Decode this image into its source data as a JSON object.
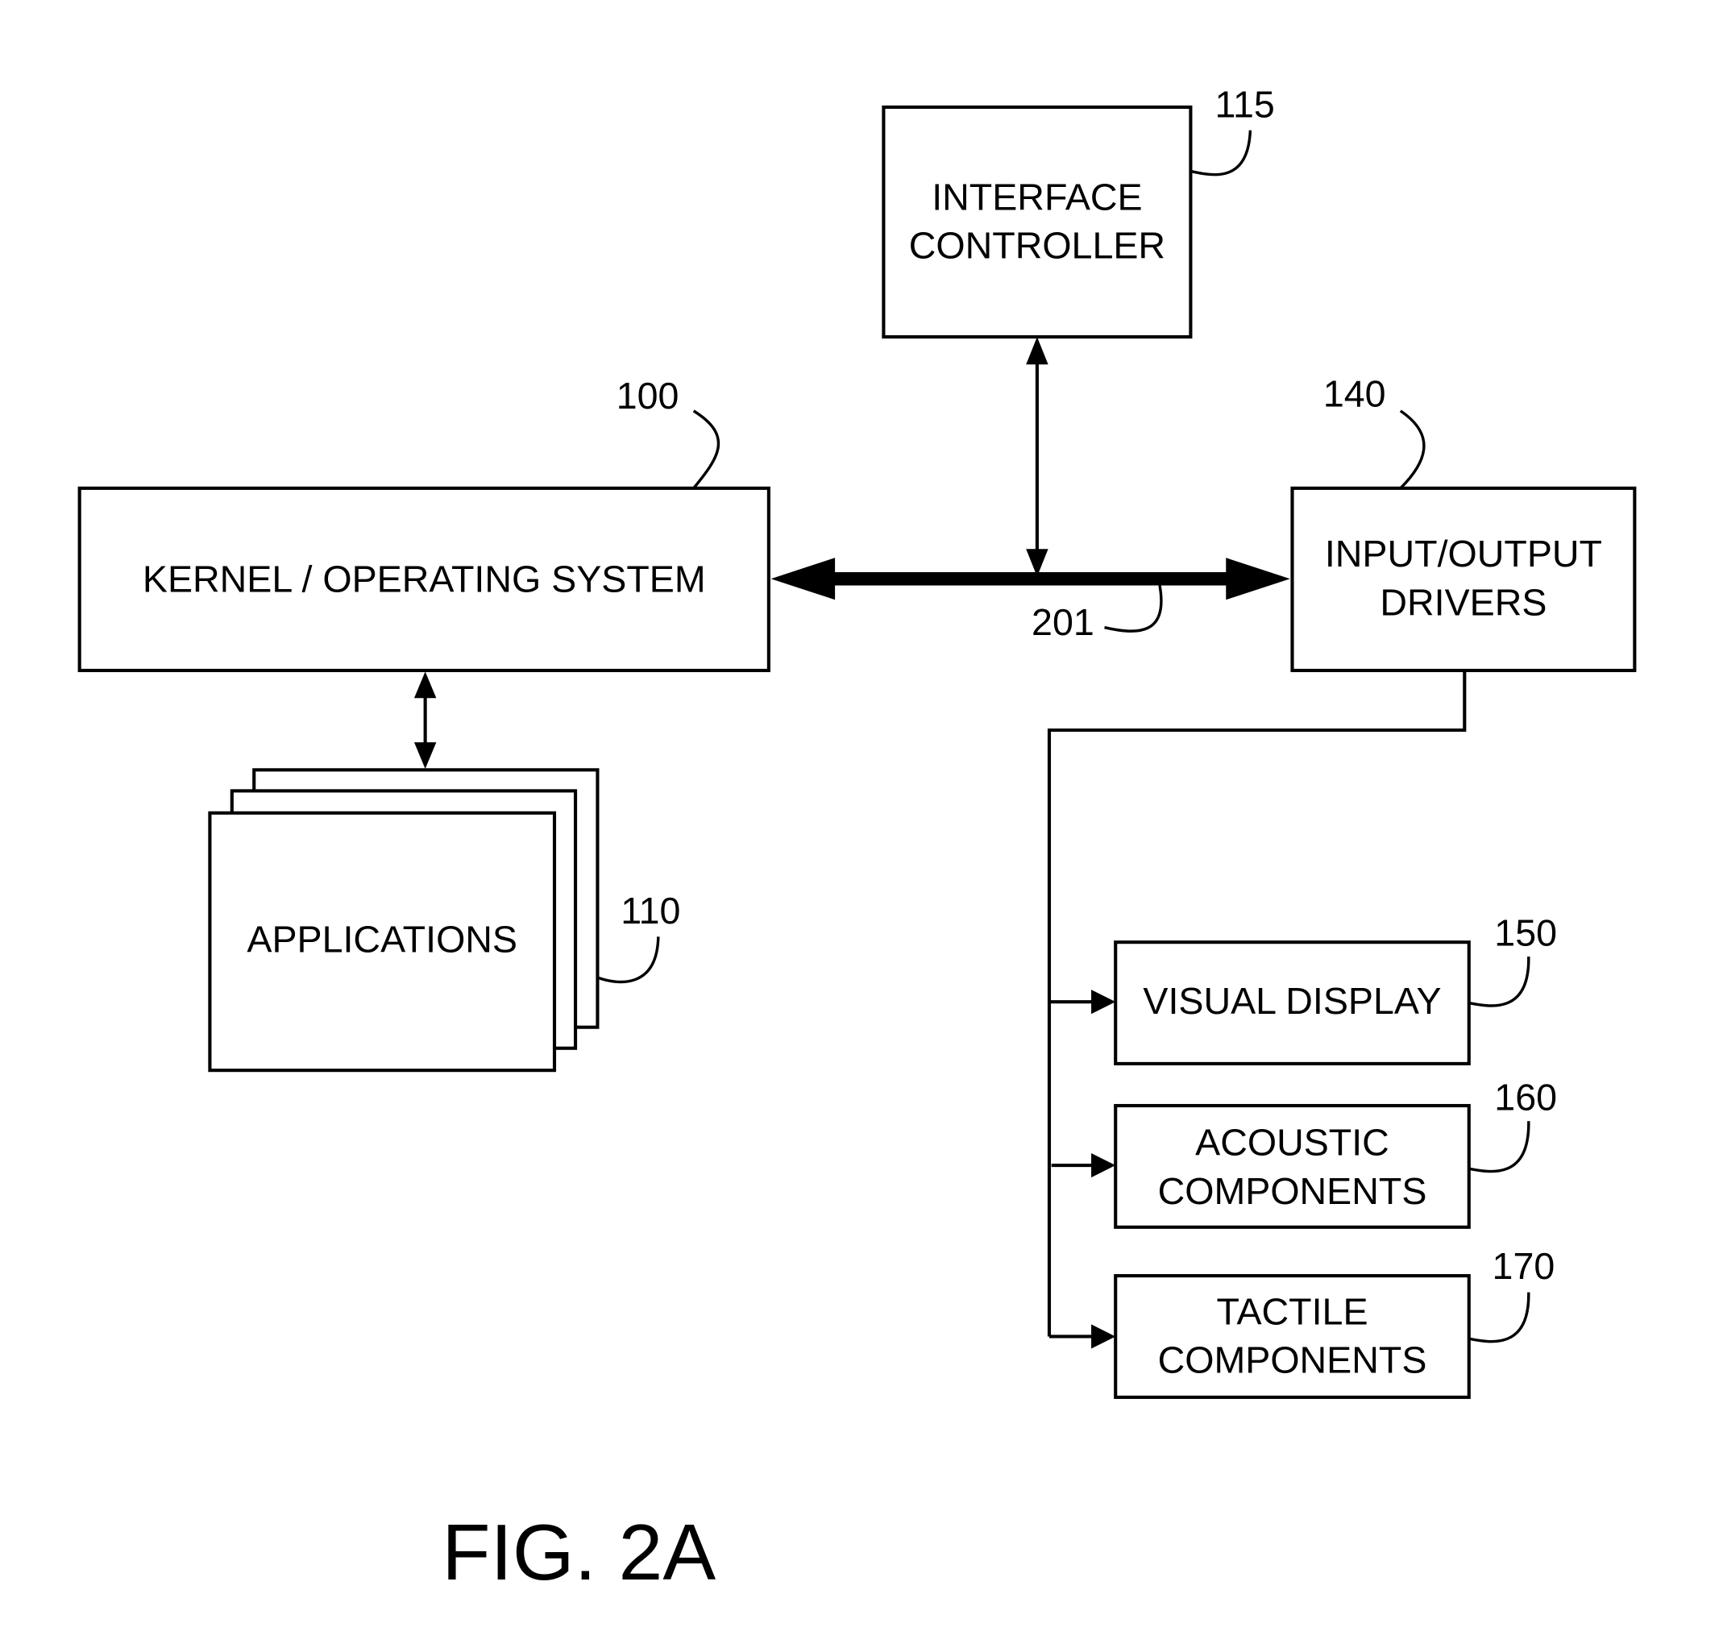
{
  "figure": {
    "title": "FIG. 2A",
    "bus": {
      "ref": "201"
    },
    "blocks": {
      "interface_controller": {
        "lines": [
          "INTERFACE",
          "CONTROLLER"
        ],
        "ref": "115"
      },
      "kernel": {
        "lines": [
          "KERNEL / OPERATING SYSTEM"
        ],
        "ref": "100"
      },
      "io_drivers": {
        "lines": [
          "INPUT/OUTPUT",
          "DRIVERS"
        ],
        "ref": "140"
      },
      "applications": {
        "lines": [
          "APPLICATIONS"
        ],
        "ref": "110"
      },
      "visual_display": {
        "lines": [
          "VISUAL DISPLAY"
        ],
        "ref": "150"
      },
      "acoustic": {
        "lines": [
          "ACOUSTIC",
          "COMPONENTS"
        ],
        "ref": "160"
      },
      "tactile": {
        "lines": [
          "TACTILE",
          "COMPONENTS"
        ],
        "ref": "170"
      }
    }
  }
}
